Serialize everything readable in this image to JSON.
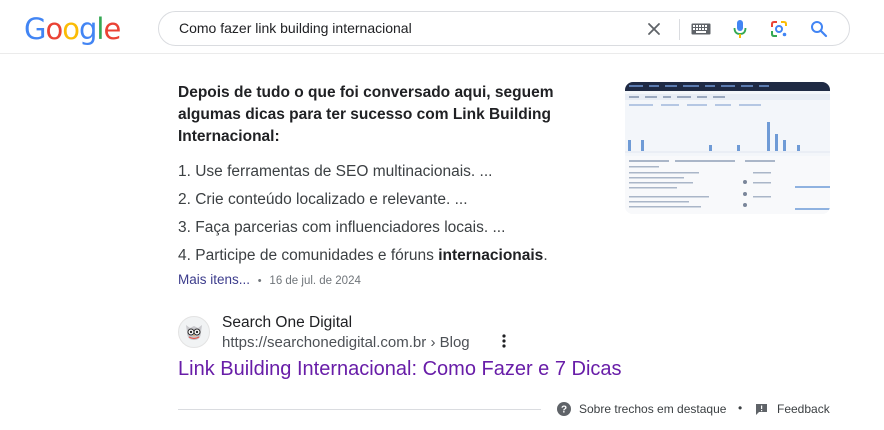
{
  "logo": {
    "letters": [
      "G",
      "o",
      "o",
      "g",
      "l",
      "e"
    ],
    "colors": [
      "#4285f4",
      "#ea4335",
      "#fbbc05",
      "#4285f4",
      "#34a853",
      "#ea4335"
    ]
  },
  "search": {
    "query": "Como fazer link building internacional",
    "icons": [
      "close-icon",
      "keyboard-icon",
      "microphone-icon",
      "lens-icon",
      "search-icon"
    ]
  },
  "snippet": {
    "title": "Depois de tudo o que foi conversado aqui, seguem algumas dicas para ter sucesso com Link Building Internacional:",
    "steps": [
      {
        "prefix": "1. Use ferramentas de SEO multinacionais. ...",
        "bold": "",
        "suffix": ""
      },
      {
        "prefix": "2. Crie conteúdo localizado e relevante. ...",
        "bold": "",
        "suffix": ""
      },
      {
        "prefix": "3. Faça parcerias com influenciadores locais. ...",
        "bold": "",
        "suffix": ""
      },
      {
        "prefix": "4. Participe de comunidades e fóruns ",
        "bold": "internacionais",
        "suffix": "."
      }
    ],
    "more_label": "Mais itens...",
    "separator": "•",
    "date": "16 de jul. de 2024"
  },
  "result": {
    "site_name": "Search One Digital",
    "url": "https://searchonedigital.com.br › Blog",
    "title": "Link Building Internacional: Como Fazer e 7 Dicas"
  },
  "footer": {
    "about_label": "Sobre trechos em destaque",
    "separator": "•",
    "feedback_label": "Feedback"
  }
}
